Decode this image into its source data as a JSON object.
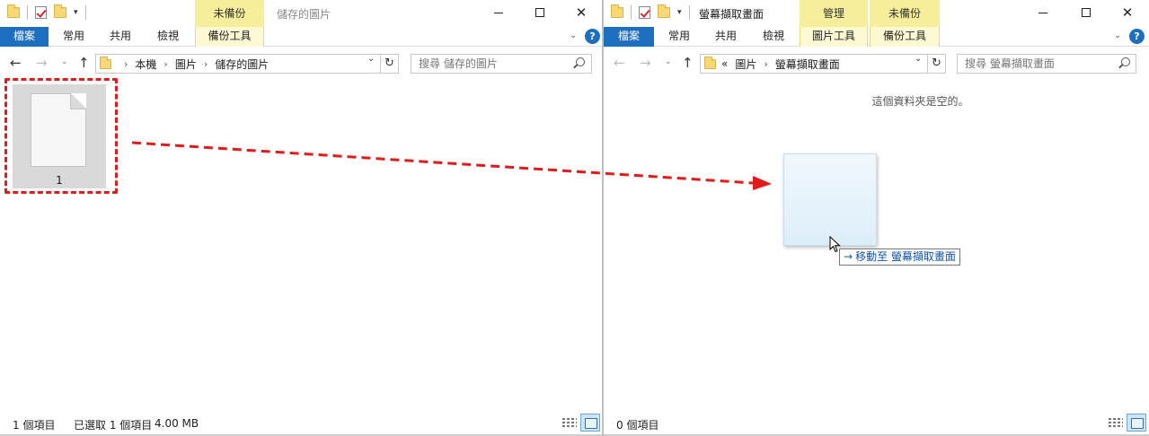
{
  "left_window": {
    "title": "儲存的圖片",
    "context_tab": "未備份",
    "tabs": {
      "file": "檔案",
      "home": "常用",
      "share": "共用",
      "view": "檢視",
      "backup_tools": "備份工具"
    },
    "breadcrumb": [
      "本機",
      "圖片",
      "儲存的圖片"
    ],
    "search_placeholder": "搜尋 儲存的圖片",
    "files": [
      {
        "name": "1"
      }
    ],
    "status": {
      "item_count": "1 個項目",
      "selection": "已選取 1 個項目",
      "size": "4.00 MB"
    }
  },
  "right_window": {
    "title": "螢幕擷取畫面",
    "context_tabs": {
      "manage": "管理",
      "unbacked": "未備份"
    },
    "tabs": {
      "file": "檔案",
      "home": "常用",
      "share": "共用",
      "view": "檢視",
      "picture_tools": "圖片工具",
      "backup_tools": "備份工具"
    },
    "breadcrumb_prefix": "«",
    "breadcrumb": [
      "圖片",
      "螢幕擷取畫面"
    ],
    "search_placeholder": "搜尋 螢幕擷取畫面",
    "empty_message": "這個資料夾是空的。",
    "drag_tooltip": "移動至 螢幕擷取畫面",
    "status": {
      "item_count": "0 個項目"
    }
  },
  "icons": {
    "back": "back-arrow-icon",
    "forward": "forward-arrow-icon",
    "up": "up-arrow-icon",
    "refresh": "refresh-icon",
    "search": "search-icon",
    "help": "help-icon",
    "minimize": "minimize-icon",
    "maximize": "maximize-icon",
    "close": "close-icon",
    "folder": "folder-icon",
    "properties": "properties-icon",
    "document": "document-icon",
    "details_view": "details-view-icon",
    "large_icons_view": "large-icons-view-icon"
  },
  "glyphs": {
    "back": "←",
    "forward": "→",
    "up": "↑",
    "refresh": "↻",
    "chevron_down": "⌄",
    "close": "✕",
    "help": "?",
    "crumb_sep": "›",
    "dropdown": "⌄",
    "qat_dropdown": "▾",
    "recent": "⌄"
  },
  "colors": {
    "file_tab": "#1c6ebf",
    "context_tab": "#f6ee9b",
    "annotation": "#e11a1a",
    "selection": "#d9d9d9"
  }
}
